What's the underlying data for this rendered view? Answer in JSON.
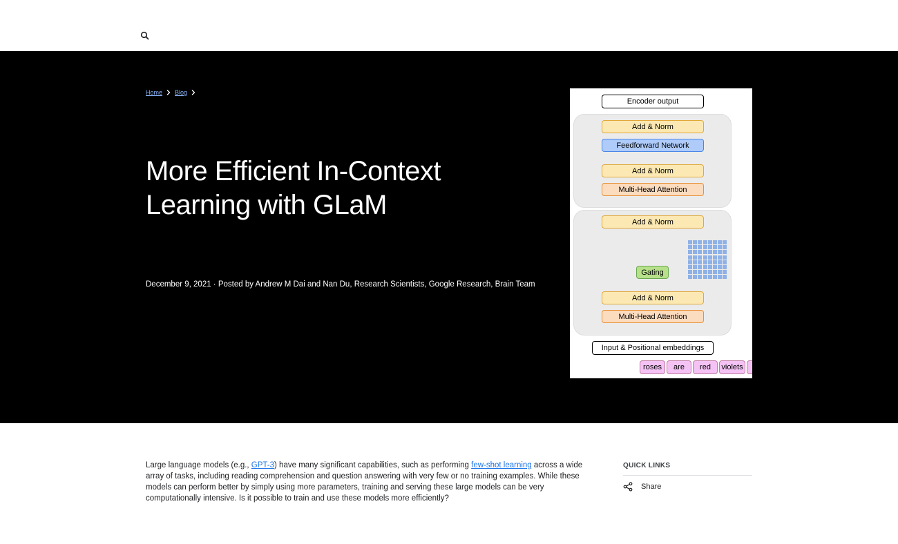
{
  "header": {
    "search_icon": "search-icon"
  },
  "breadcrumb": [
    {
      "label": "Home"
    },
    {
      "label": "Blog"
    }
  ],
  "article": {
    "title_line1": "More Efficient In-Context",
    "title_line2": "Learning with GLaM",
    "byline": "December 9, 2021 · Posted by Andrew M Dai and Nan Du, Research Scientists, Google Research, Brain Team",
    "intro_before_gpt3": "Large language models (e.g., ",
    "gpt3_link": "GPT-3",
    "intro_after_gpt3": ") have many significant capabilities, such as performing ",
    "fewshot_link": "few-shot learning",
    "intro_rest": " across a wide array of tasks, including reading comprehension and question answering with very few or no training examples. While these models can perform better by simply using more parameters, training and serving these large models can be very computationally intensive. Is it possible to train and use these models more efficiently?"
  },
  "figure": {
    "encoder_output": "Encoder output",
    "add_norm": "Add & Norm",
    "feedforward": "Feedforward Network",
    "mha": "Multi-Head Attention",
    "gating": "Gating",
    "input_embeddings": "Input & Positional embeddings",
    "tokens": [
      "roses",
      "are",
      "red",
      "violets"
    ]
  },
  "sidebar": {
    "quick_links": "QUICK LINKS",
    "share": "Share"
  }
}
